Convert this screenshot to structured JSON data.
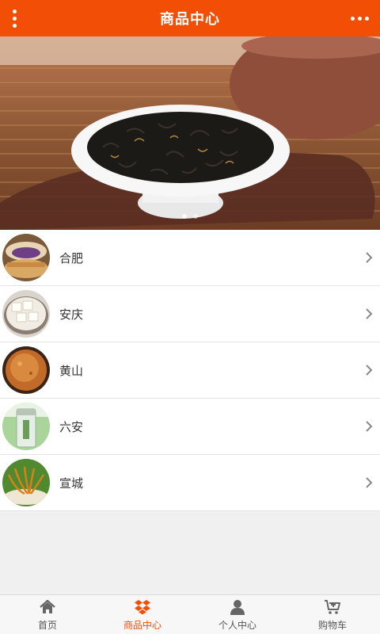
{
  "header": {
    "title": "商品中心",
    "menu_icon": "vertical-dots-icon",
    "more_icon": "horizontal-dots-icon"
  },
  "banner": {
    "image": "tea-leaves-in-white-dish",
    "slide_count": 2,
    "active_slide": 1
  },
  "categories": [
    {
      "label": "合肥",
      "thumb": "pastry-cake"
    },
    {
      "label": "安庆",
      "thumb": "tofu-bowl"
    },
    {
      "label": "黄山",
      "thumb": "baked-flatbread"
    },
    {
      "label": "六安",
      "thumb": "tea-canister"
    },
    {
      "label": "宣城",
      "thumb": "dried-noodles"
    }
  ],
  "tabbar": {
    "items": [
      {
        "label": "首页",
        "icon": "home-icon"
      },
      {
        "label": "商品中心",
        "icon": "products-icon"
      },
      {
        "label": "个人中心",
        "icon": "user-icon"
      },
      {
        "label": "购物车",
        "icon": "cart-icon"
      }
    ],
    "active_index": 1
  },
  "colors": {
    "accent": "#f34e06",
    "inactive_icon": "#666666"
  }
}
